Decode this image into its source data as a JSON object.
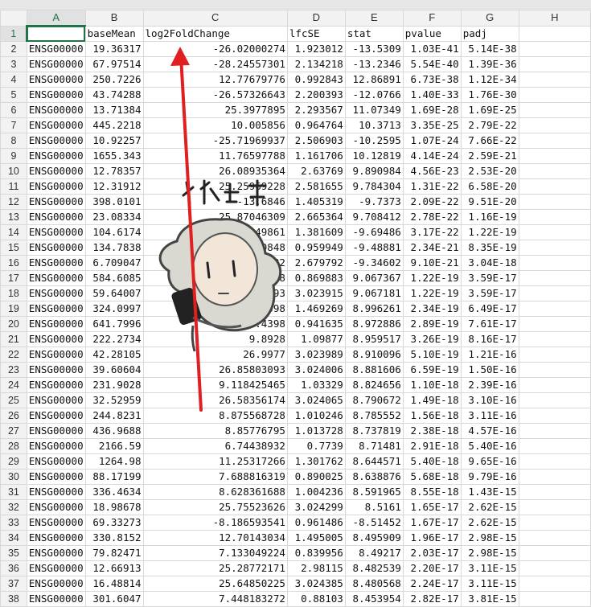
{
  "columns": [
    "A",
    "B",
    "C",
    "D",
    "E",
    "F",
    "G",
    "H"
  ],
  "active_cell": "A1",
  "header_row": [
    "",
    "baseMean",
    "log2FoldChange",
    "lfcSE",
    "stat",
    "pvalue",
    "padj",
    ""
  ],
  "rows": [
    {
      "n": "2",
      "v": [
        "ENSG00000",
        "19.36317",
        "-26.02000274",
        "1.923012",
        "-13.5309",
        "1.03E-41",
        "5.14E-38",
        ""
      ]
    },
    {
      "n": "3",
      "v": [
        "ENSG00000",
        "67.97514",
        "-28.24557301",
        "2.134218",
        "-13.2346",
        "5.54E-40",
        "1.39E-36",
        ""
      ]
    },
    {
      "n": "4",
      "v": [
        "ENSG00000",
        "250.7226",
        "12.77679776",
        "0.992843",
        "12.86891",
        "6.73E-38",
        "1.12E-34",
        ""
      ]
    },
    {
      "n": "5",
      "v": [
        "ENSG00000",
        "43.74288",
        "-26.57326643",
        "2.200393",
        "-12.0766",
        "1.40E-33",
        "1.76E-30",
        ""
      ]
    },
    {
      "n": "6",
      "v": [
        "ENSG00000",
        "13.71384",
        "25.3977895",
        "2.293567",
        "11.07349",
        "1.69E-28",
        "1.69E-25",
        ""
      ]
    },
    {
      "n": "7",
      "v": [
        "ENSG00000",
        "445.2218",
        "10.005856",
        "0.964764",
        "10.3713",
        "3.35E-25",
        "2.79E-22",
        ""
      ]
    },
    {
      "n": "8",
      "v": [
        "ENSG00000",
        "10.92257",
        "-25.71969937",
        "2.506903",
        "-10.2595",
        "1.07E-24",
        "7.66E-22",
        ""
      ]
    },
    {
      "n": "9",
      "v": [
        "ENSG00000",
        "1655.343",
        "11.76597788",
        "1.161706",
        "10.12819",
        "4.14E-24",
        "2.59E-21",
        ""
      ]
    },
    {
      "n": "10",
      "v": [
        "ENSG00000",
        "12.78357",
        "26.08935364",
        "2.63769",
        "9.890984",
        "4.56E-23",
        "2.53E-20",
        ""
      ]
    },
    {
      "n": "11",
      "v": [
        "ENSG00000",
        "12.31912",
        "25.25969228",
        "2.581655",
        "9.784304",
        "1.31E-22",
        "6.58E-20",
        ""
      ]
    },
    {
      "n": "12",
      "v": [
        "ENSG00000",
        "398.0101",
        "-13.6846",
        "1.405319",
        "-9.7373",
        "2.09E-22",
        "9.51E-20",
        ""
      ]
    },
    {
      "n": "13",
      "v": [
        "ENSG00000",
        "23.08334",
        "25.87046309",
        "2.665364",
        "9.708412",
        "2.78E-22",
        "1.16E-19",
        ""
      ]
    },
    {
      "n": "14",
      "v": [
        "ENSG00000",
        "104.6174",
        "-13.39449861",
        "1.381609",
        "-9.69486",
        "3.17E-22",
        "1.22E-19",
        ""
      ]
    },
    {
      "n": "15",
      "v": [
        "ENSG00000",
        "134.7838",
        "9.080848",
        "0.959949",
        "-9.48881",
        "2.34E-21",
        "8.35E-19",
        ""
      ]
    },
    {
      "n": "16",
      "v": [
        "ENSG00000",
        "6.709047",
        "-25.0082",
        "2.679792",
        "-9.34602",
        "9.10E-21",
        "3.04E-18",
        ""
      ]
    },
    {
      "n": "17",
      "v": [
        "ENSG00000",
        "584.6085",
        "7.88",
        "0.869883",
        "9.067367",
        "1.22E-19",
        "3.59E-17",
        ""
      ]
    },
    {
      "n": "18",
      "v": [
        "ENSG00000",
        "59.64007",
        "27.4493",
        "3.023915",
        "9.067181",
        "1.22E-19",
        "3.59E-17",
        ""
      ]
    },
    {
      "n": "19",
      "v": [
        "ENSG00000",
        "324.0997",
        "13.2398",
        "1.469269",
        "8.996261",
        "2.34E-19",
        "6.49E-17",
        ""
      ]
    },
    {
      "n": "20",
      "v": [
        "ENSG00000",
        "641.7996",
        "8.4398",
        "0.941635",
        "8.972886",
        "2.89E-19",
        "7.61E-17",
        ""
      ]
    },
    {
      "n": "21",
      "v": [
        "ENSG00000",
        "222.2734",
        "9.8928",
        "1.09877",
        "8.959517",
        "3.26E-19",
        "8.16E-17",
        ""
      ]
    },
    {
      "n": "22",
      "v": [
        "ENSG00000",
        "42.28105",
        "26.9977",
        "3.023989",
        "8.910096",
        "5.10E-19",
        "1.21E-16",
        ""
      ]
    },
    {
      "n": "23",
      "v": [
        "ENSG00000",
        "39.60604",
        "26.85803093",
        "3.024006",
        "8.881606",
        "6.59E-19",
        "1.50E-16",
        ""
      ]
    },
    {
      "n": "24",
      "v": [
        "ENSG00000",
        "231.9028",
        "9.118425465",
        "1.03329",
        "8.824656",
        "1.10E-18",
        "2.39E-16",
        ""
      ]
    },
    {
      "n": "25",
      "v": [
        "ENSG00000",
        "32.52959",
        "26.58356174",
        "3.024065",
        "8.790672",
        "1.49E-18",
        "3.10E-16",
        ""
      ]
    },
    {
      "n": "26",
      "v": [
        "ENSG00000",
        "244.8231",
        "8.875568728",
        "1.010246",
        "8.785552",
        "1.56E-18",
        "3.11E-16",
        ""
      ]
    },
    {
      "n": "27",
      "v": [
        "ENSG00000",
        "436.9688",
        "8.85776795",
        "1.013728",
        "8.737819",
        "2.38E-18",
        "4.57E-16",
        ""
      ]
    },
    {
      "n": "28",
      "v": [
        "ENSG00000",
        "2166.59",
        "6.74438932",
        "0.7739",
        "8.71481",
        "2.91E-18",
        "5.40E-16",
        ""
      ]
    },
    {
      "n": "29",
      "v": [
        "ENSG00000",
        "1264.98",
        "11.25317266",
        "1.301762",
        "8.644571",
        "5.40E-18",
        "9.65E-16",
        ""
      ]
    },
    {
      "n": "30",
      "v": [
        "ENSG00000",
        "88.17199",
        "7.688816319",
        "0.890025",
        "8.638876",
        "5.68E-18",
        "9.79E-16",
        ""
      ]
    },
    {
      "n": "31",
      "v": [
        "ENSG00000",
        "336.4634",
        "8.628361688",
        "1.004236",
        "8.591965",
        "8.55E-18",
        "1.43E-15",
        ""
      ]
    },
    {
      "n": "32",
      "v": [
        "ENSG00000",
        "18.98678",
        "25.75523626",
        "3.024299",
        "8.5161",
        "1.65E-17",
        "2.62E-15",
        ""
      ]
    },
    {
      "n": "33",
      "v": [
        "ENSG00000",
        "69.33273",
        "-8.186593541",
        "0.961486",
        "-8.51452",
        "1.67E-17",
        "2.62E-15",
        ""
      ]
    },
    {
      "n": "34",
      "v": [
        "ENSG00000",
        "330.8152",
        "12.70143034",
        "1.495005",
        "8.495909",
        "1.96E-17",
        "2.98E-15",
        ""
      ]
    },
    {
      "n": "35",
      "v": [
        "ENSG00000",
        "79.82471",
        "7.133049224",
        "0.839956",
        "8.49217",
        "2.03E-17",
        "2.98E-15",
        ""
      ]
    },
    {
      "n": "36",
      "v": [
        "ENSG00000",
        "12.66913",
        "25.28772171",
        "2.98115",
        "8.482539",
        "2.20E-17",
        "3.11E-15",
        ""
      ]
    },
    {
      "n": "37",
      "v": [
        "ENSG00000",
        "16.48814",
        "25.64850225",
        "3.024385",
        "8.480568",
        "2.24E-17",
        "3.11E-15",
        ""
      ]
    },
    {
      "n": "38",
      "v": [
        "ENSG00000",
        "301.6047",
        "7.448183272",
        "0.88103",
        "8.453954",
        "2.82E-17",
        "3.81E-15",
        ""
      ]
    }
  ],
  "sticker": {
    "caption": "为 你 点 赞"
  },
  "colors": {
    "accent": "#217346",
    "arrow": "#e02020"
  }
}
